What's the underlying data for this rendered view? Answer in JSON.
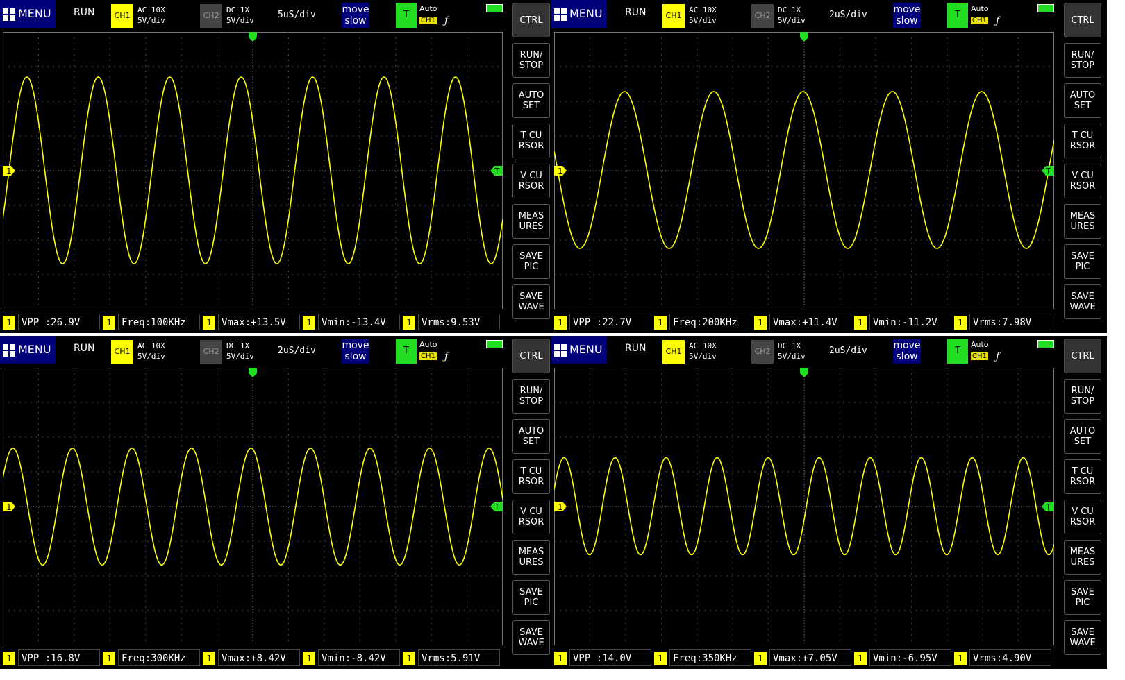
{
  "common": {
    "menu_label": "MENU",
    "run_label": "RUN",
    "ch1_label": "CH1",
    "ch2_label": "CH2",
    "ch1_coupling": "AC 10X",
    "ch1_scale": "5V/div",
    "ch2_coupling": "DC 1X",
    "ch2_scale": "5V/div",
    "move_line1": "move",
    "move_line2": "slow",
    "trigger_label": "T",
    "trigger_mode": "Auto",
    "trigger_source": "CH1",
    "trigger_edge": "ƒ",
    "ch_marker": "1",
    "trig_marker": "T",
    "sidebar": [
      "CTRL",
      "RUN/\nSTOP",
      "AUTO\nSET",
      "T CU\nRSOR",
      "V CU\nRSOR",
      "MEAS\nURES",
      "SAVE\nPIC",
      "SAVE\nWAVE"
    ],
    "meas_badge": "1",
    "colors": {
      "trace": "#ffff00",
      "menu": "#00007a",
      "trigger": "#22dd22",
      "grid": "#4a4a4a"
    }
  },
  "panels": [
    {
      "timebase": "5uS/div",
      "measures": [
        "VPP :26.9V",
        "Freq:100KHz",
        "Vmax:+13.5V",
        "Vmin:-13.4V",
        "Vrms:9.53V"
      ],
      "signal": {
        "frequency_khz": 100,
        "vmax": 13.5,
        "vmin": -13.4,
        "time_per_div_us": 5
      }
    },
    {
      "timebase": "2uS/div",
      "measures": [
        "VPP :22.7V",
        "Freq:200KHz",
        "Vmax:+11.4V",
        "Vmin:-11.2V",
        "Vrms:7.98V"
      ],
      "signal": {
        "frequency_khz": 200,
        "vmax": 11.4,
        "vmin": -11.2,
        "time_per_div_us": 2
      }
    },
    {
      "timebase": "2uS/div",
      "measures": [
        "VPP :16.8V",
        "Freq:300KHz",
        "Vmax:+8.42V",
        "Vmin:-8.42V",
        "Vrms:5.91V"
      ],
      "signal": {
        "frequency_khz": 300,
        "vmax": 8.42,
        "vmin": -8.42,
        "time_per_div_us": 2
      }
    },
    {
      "timebase": "2uS/div",
      "measures": [
        "VPP :14.0V",
        "Freq:350KHz",
        "Vmax:+7.05V",
        "Vmin:-6.95V",
        "Vrms:4.90V"
      ],
      "signal": {
        "frequency_khz": 350,
        "vmax": 7.05,
        "vmin": -6.95,
        "time_per_div_us": 2
      }
    }
  ]
}
